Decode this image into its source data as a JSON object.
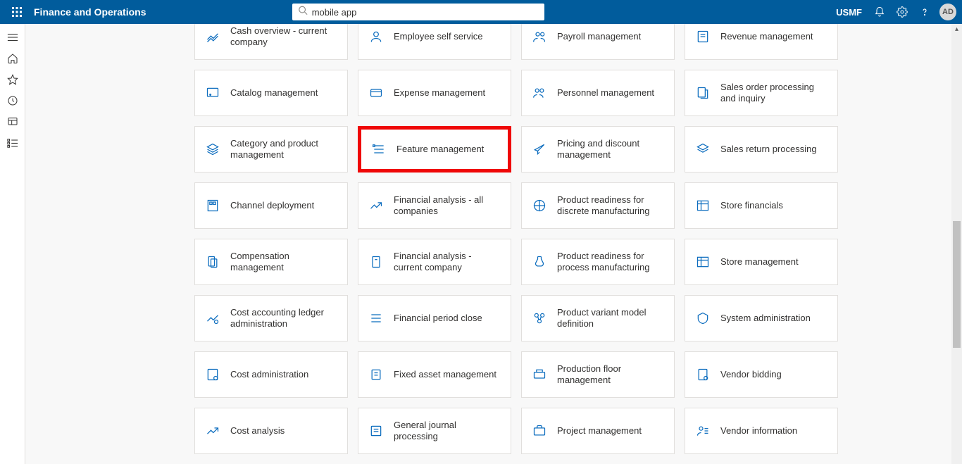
{
  "header": {
    "app_title": "Finance and Operations",
    "search_value": "mobile app",
    "legal_entity": "USMF",
    "avatar_initials": "AD"
  },
  "tiles": [
    "Cash overview - current company",
    "Employee self service",
    "Payroll management",
    "Revenue management",
    "Catalog management",
    "Expense management",
    "Personnel management",
    "Sales order processing and inquiry",
    "Category and product management",
    "Feature management",
    "Pricing and discount management",
    "Sales return processing",
    "Channel deployment",
    "Financial analysis - all companies",
    "Product readiness for discrete manufacturing",
    "Store financials",
    "Compensation management",
    "Financial analysis - current company",
    "Product readiness for process manufacturing",
    "Store management",
    "Cost accounting ledger administration",
    "Financial period close",
    "Product variant model definition",
    "System administration",
    "Cost administration",
    "Fixed asset management",
    "Production floor management",
    "Vendor bidding",
    "Cost analysis",
    "General journal processing",
    "Project management",
    "Vendor information"
  ],
  "highlighted_index": 9
}
